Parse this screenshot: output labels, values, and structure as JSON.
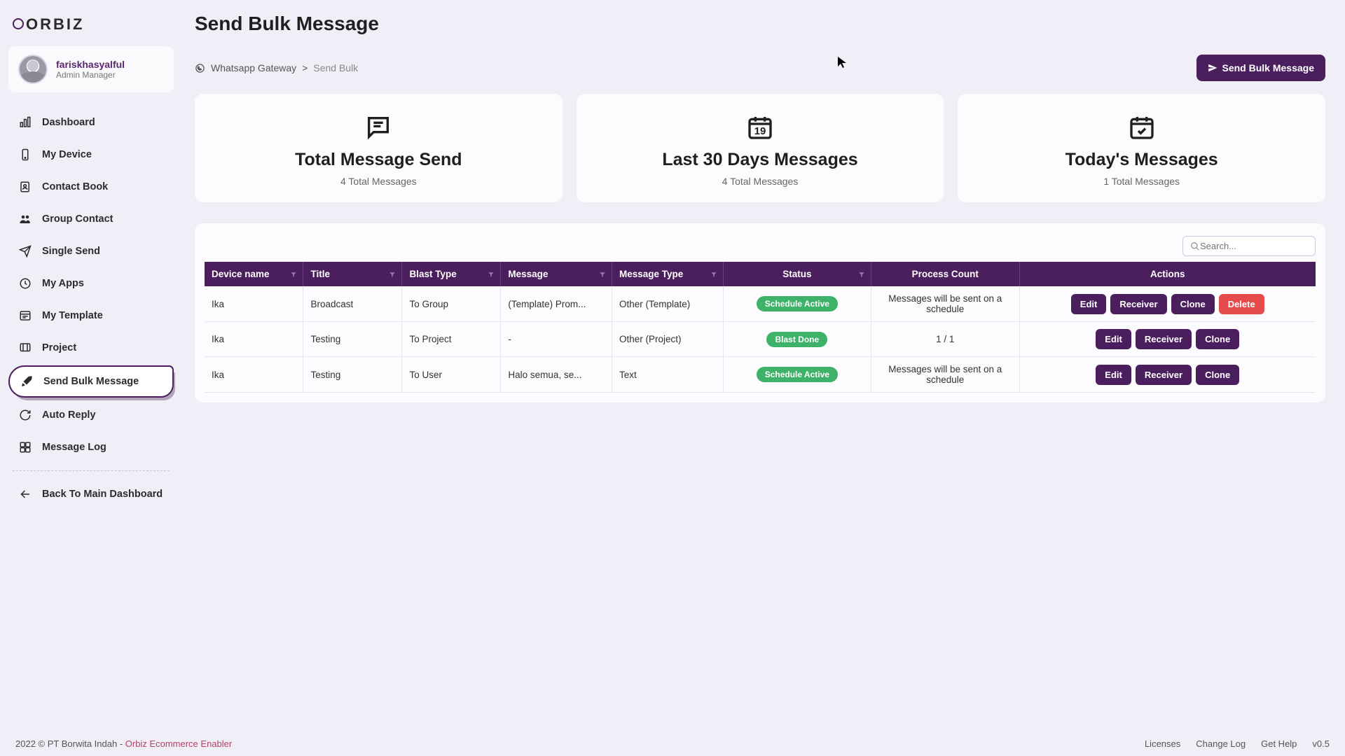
{
  "brand": "ORBIZ",
  "user": {
    "name": "fariskhasyalful",
    "role": "Admin Manager"
  },
  "page_title": "Send Bulk Message",
  "breadcrumb": {
    "root": "Whatsapp Gateway",
    "sep": ">",
    "current": "Send Bulk"
  },
  "primary_button": "Send Bulk Message",
  "sidebar": {
    "items": [
      {
        "label": "Dashboard"
      },
      {
        "label": "My Device"
      },
      {
        "label": "Contact Book"
      },
      {
        "label": "Group Contact"
      },
      {
        "label": "Single Send"
      },
      {
        "label": "My Apps"
      },
      {
        "label": "My Template"
      },
      {
        "label": "Project"
      },
      {
        "label": "Send Bulk Message"
      },
      {
        "label": "Auto Reply"
      },
      {
        "label": "Message Log"
      }
    ],
    "back": "Back To Main Dashboard"
  },
  "cards": [
    {
      "title": "Total Message Send",
      "subtitle": "4 Total Messages"
    },
    {
      "title": "Last 30 Days Messages",
      "subtitle": "4 Total Messages",
      "day": "19"
    },
    {
      "title": "Today's Messages",
      "subtitle": "1 Total Messages"
    }
  ],
  "search_placeholder": "Search...",
  "columns": [
    "Device name",
    "Title",
    "Blast Type",
    "Message",
    "Message Type",
    "Status",
    "Process Count",
    "Actions"
  ],
  "rows": [
    {
      "device": "Ika",
      "title": "Broadcast",
      "blast": "To Group",
      "message": "(Template) Prom...",
      "mtype": "Other (Template)",
      "status": "Schedule Active",
      "status_class": "status-active",
      "process": "Messages will be sent on a schedule",
      "actions": [
        "Edit",
        "Receiver",
        "Clone",
        "Delete"
      ]
    },
    {
      "device": "Ika",
      "title": "Testing",
      "blast": "To Project",
      "message": "-",
      "mtype": "Other (Project)",
      "status": "Blast Done",
      "status_class": "status-done",
      "process": "1 / 1",
      "actions": [
        "Edit",
        "Receiver",
        "Clone"
      ]
    },
    {
      "device": "Ika",
      "title": "Testing",
      "blast": "To User",
      "message": "Halo semua, se...",
      "mtype": "Text",
      "status": "Schedule Active",
      "status_class": "status-active",
      "process": "Messages will be sent on a schedule",
      "actions": [
        "Edit",
        "Receiver",
        "Clone"
      ]
    }
  ],
  "footer": {
    "left_prefix": "2022 © PT Borwita Indah - ",
    "left_link": "Orbiz Ecommerce Enabler",
    "links": [
      "Licenses",
      "Change Log",
      "Get Help"
    ],
    "version": "v0.5"
  }
}
